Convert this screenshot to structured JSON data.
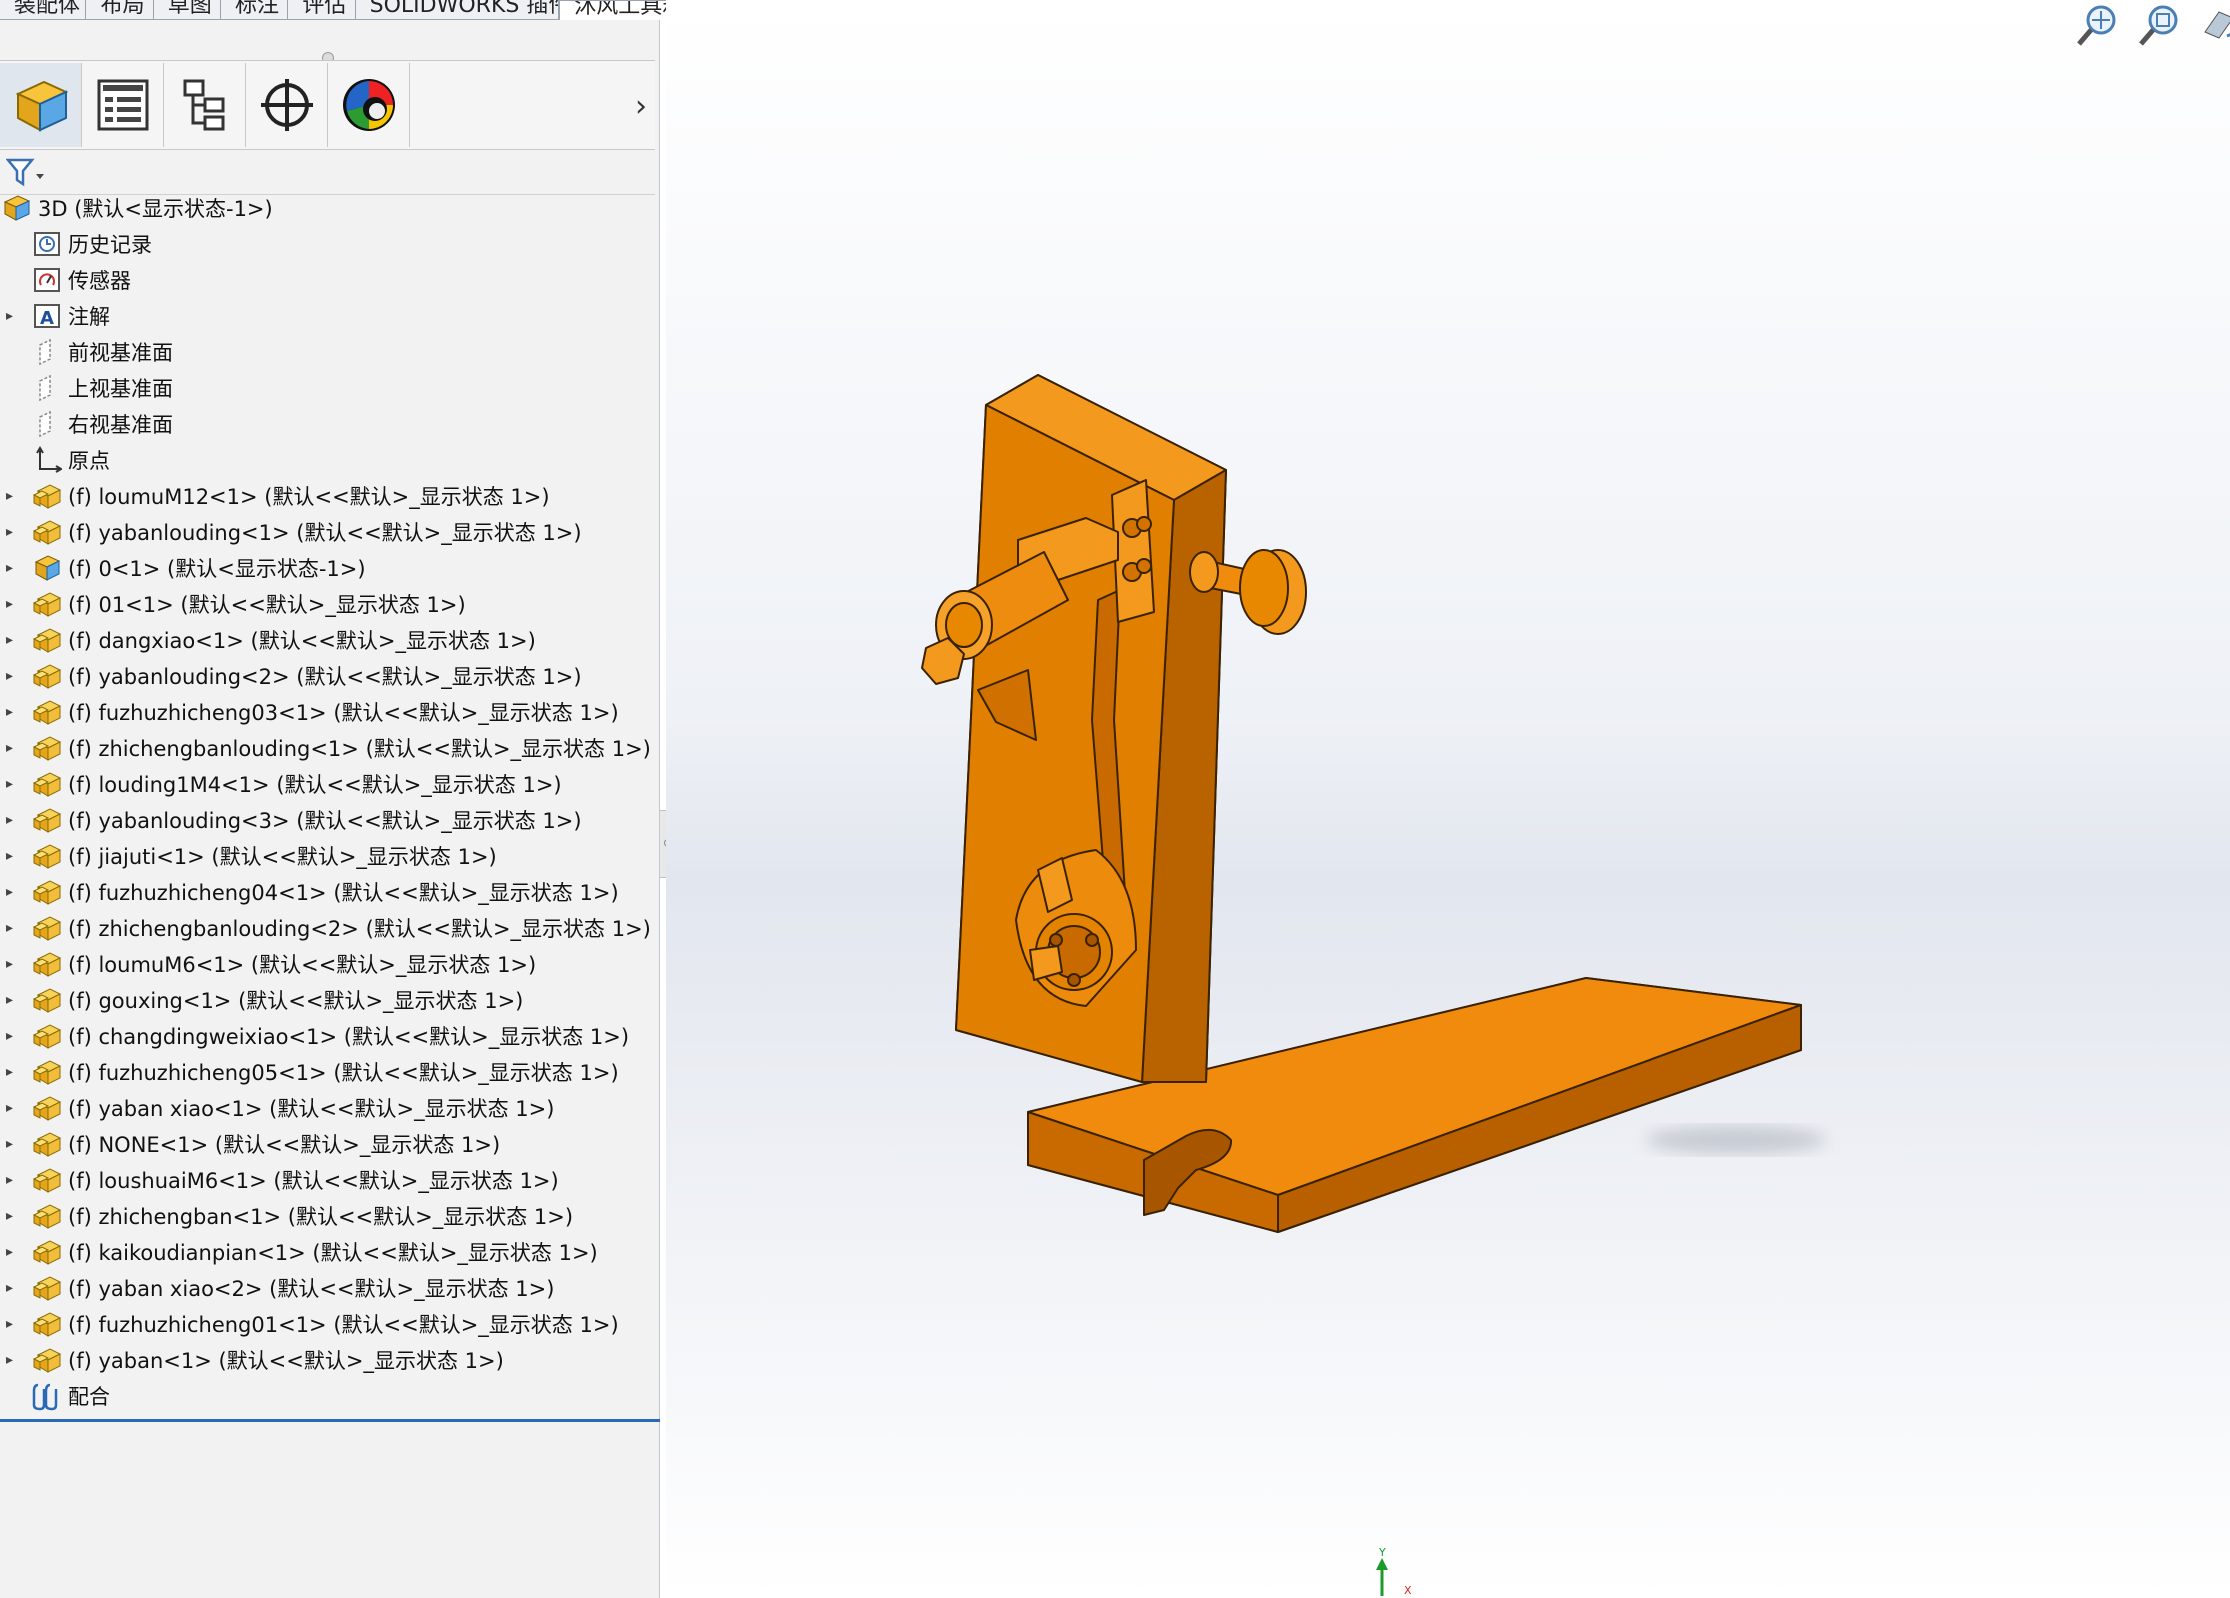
{
  "tabs": [
    "装配体",
    "布局",
    "草图",
    "标注",
    "评估",
    "SOLIDWORKS 插件",
    "沐风工具箱"
  ],
  "active_tab_index": 6,
  "panel_tabs": [
    {
      "name": "feature-manager-tab",
      "icon": "assembly-cube-icon"
    },
    {
      "name": "property-manager-tab",
      "icon": "property-list-icon"
    },
    {
      "name": "configuration-manager-tab",
      "icon": "configuration-tree-icon"
    },
    {
      "name": "dimxpert-manager-tab",
      "icon": "crosshair-icon"
    },
    {
      "name": "display-manager-tab",
      "icon": "color-sphere-icon"
    }
  ],
  "panel_expand": "›",
  "tree": {
    "root": "3D  (默认<显示状态-1>)",
    "items": [
      {
        "label": "历史记录",
        "icon": "history-icon",
        "expandable": false
      },
      {
        "label": "传感器",
        "icon": "sensor-icon",
        "expandable": false
      },
      {
        "label": "注解",
        "icon": "annotation-icon",
        "expandable": true
      },
      {
        "label": "前视基准面",
        "icon": "plane-icon",
        "expandable": false
      },
      {
        "label": "上视基准面",
        "icon": "plane-icon",
        "expandable": false
      },
      {
        "label": "右视基准面",
        "icon": "plane-icon",
        "expandable": false
      },
      {
        "label": "原点",
        "icon": "origin-icon",
        "expandable": false
      },
      {
        "label": "(f) loumuM12<1> (默认<<默认>_显示状态 1>)",
        "icon": "part-icon",
        "expandable": true
      },
      {
        "label": "(f) yabanlouding<1> (默认<<默认>_显示状态 1>)",
        "icon": "part-icon",
        "expandable": true
      },
      {
        "label": "(f) 0<1> (默认<显示状态-1>)",
        "icon": "subassembly-icon",
        "expandable": true
      },
      {
        "label": "(f) 01<1> (默认<<默认>_显示状态 1>)",
        "icon": "part-icon",
        "expandable": true
      },
      {
        "label": "(f) dangxiao<1> (默认<<默认>_显示状态 1>)",
        "icon": "part-icon",
        "expandable": true
      },
      {
        "label": "(f) yabanlouding<2> (默认<<默认>_显示状态 1>)",
        "icon": "part-icon",
        "expandable": true
      },
      {
        "label": "(f) fuzhuzhicheng03<1> (默认<<默认>_显示状态 1>)",
        "icon": "part-icon",
        "expandable": true
      },
      {
        "label": "(f) zhichengbanlouding<1> (默认<<默认>_显示状态 1>)",
        "icon": "part-icon",
        "expandable": true
      },
      {
        "label": "(f) louding1M4<1> (默认<<默认>_显示状态 1>)",
        "icon": "part-icon",
        "expandable": true
      },
      {
        "label": "(f) yabanlouding<3> (默认<<默认>_显示状态 1>)",
        "icon": "part-icon",
        "expandable": true
      },
      {
        "label": "(f) jiajuti<1> (默认<<默认>_显示状态 1>)",
        "icon": "part-icon",
        "expandable": true
      },
      {
        "label": "(f) fuzhuzhicheng04<1> (默认<<默认>_显示状态 1>)",
        "icon": "part-icon",
        "expandable": true
      },
      {
        "label": "(f) zhichengbanlouding<2> (默认<<默认>_显示状态 1>)",
        "icon": "part-icon",
        "expandable": true
      },
      {
        "label": "(f) loumuM6<1> (默认<<默认>_显示状态 1>)",
        "icon": "part-icon",
        "expandable": true
      },
      {
        "label": "(f) gouxing<1> (默认<<默认>_显示状态 1>)",
        "icon": "part-icon",
        "expandable": true
      },
      {
        "label": "(f) changdingweixiao<1> (默认<<默认>_显示状态 1>)",
        "icon": "part-icon",
        "expandable": true
      },
      {
        "label": "(f) fuzhuzhicheng05<1> (默认<<默认>_显示状态 1>)",
        "icon": "part-icon",
        "expandable": true
      },
      {
        "label": "(f) yaban xiao<1> (默认<<默认>_显示状态 1>)",
        "icon": "part-icon",
        "expandable": true
      },
      {
        "label": "(f) NONE<1> (默认<<默认>_显示状态 1>)",
        "icon": "part-icon",
        "expandable": true
      },
      {
        "label": "(f) loushuaiM6<1> (默认<<默认>_显示状态 1>)",
        "icon": "part-icon",
        "expandable": true
      },
      {
        "label": "(f) zhichengban<1> (默认<<默认>_显示状态 1>)",
        "icon": "part-icon",
        "expandable": true
      },
      {
        "label": "(f) kaikoudianpian<1> (默认<<默认>_显示状态 1>)",
        "icon": "part-icon",
        "expandable": true
      },
      {
        "label": "(f) yaban xiao<2> (默认<<默认>_显示状态 1>)",
        "icon": "part-icon",
        "expandable": true
      },
      {
        "label": "(f) fuzhuzhicheng01<1> (默认<<默认>_显示状态 1>)",
        "icon": "part-icon",
        "expandable": true
      },
      {
        "label": "(f) yaban<1> (默认<<默认>_显示状态 1>)",
        "icon": "part-icon",
        "expandable": true
      },
      {
        "label": "配合",
        "icon": "mates-icon",
        "expandable": false
      }
    ]
  },
  "heads_up_toolbar": [
    {
      "name": "zoom-to-fit",
      "icon": "zoom-to-fit-icon",
      "dropdown": false
    },
    {
      "name": "zoom-to-area",
      "icon": "zoom-area-icon",
      "dropdown": false
    },
    {
      "name": "previous-view",
      "icon": "previous-view-icon",
      "dropdown": false
    },
    {
      "name": "section-view",
      "icon": "section-view-icon",
      "dropdown": false
    },
    {
      "name": "dynamic-annotation",
      "icon": "annotation-view-icon",
      "dropdown": false
    },
    {
      "name": "view-orientation",
      "icon": "view-orientation-icon",
      "dropdown": true
    },
    {
      "name": "display-style",
      "icon": "display-style-icon",
      "dropdown": true
    },
    {
      "name": "hide-show-items",
      "icon": "eye-icon",
      "dropdown": true
    },
    {
      "name": "edit-appearance",
      "icon": "appearance-icon",
      "dropdown": true
    },
    {
      "name": "apply-scene",
      "icon": "scene-icon",
      "dropdown": true
    },
    {
      "name": "view-settings",
      "icon": "monitor-icon",
      "dropdown": true
    }
  ],
  "triad": {
    "y_label": "Y",
    "x_label": "X"
  },
  "colors": {
    "model": "#E07B00",
    "model_dark": "#B86200",
    "model_light": "#F39A1E",
    "selection_line": "#2A69B5",
    "panel_bg": "#F2F2F2"
  }
}
